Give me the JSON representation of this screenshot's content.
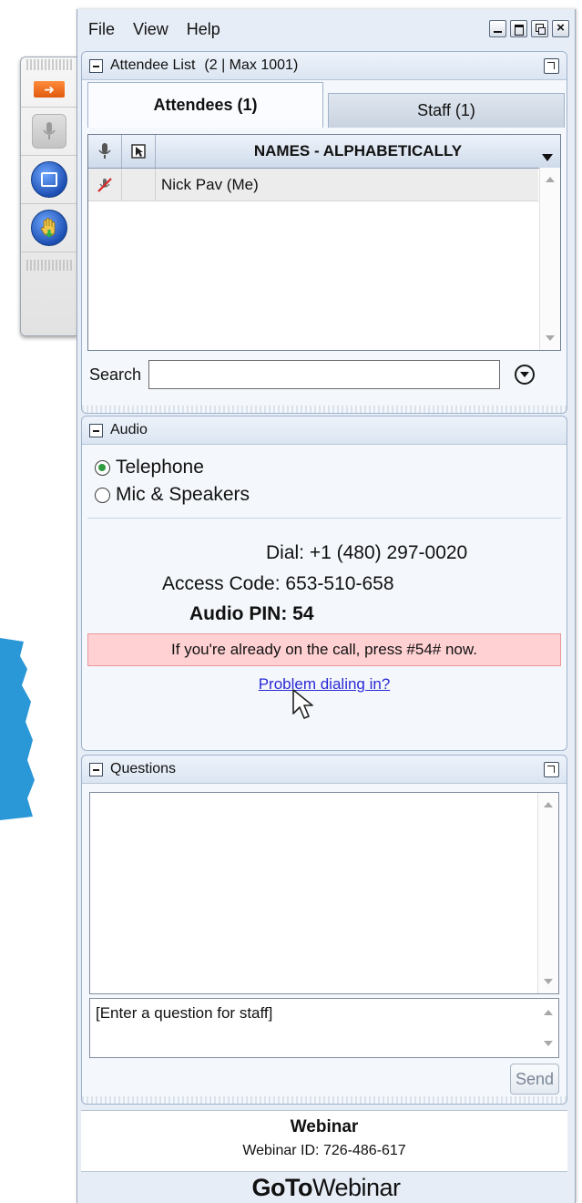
{
  "menu": {
    "file": "File",
    "view": "View",
    "help": "Help"
  },
  "attendee_list": {
    "title": "Attendee List",
    "count": "(2 | Max 1001)",
    "tabs": [
      {
        "label": "Attendees (1)"
      },
      {
        "label": "Staff (1)"
      }
    ],
    "column_header": "NAMES - ALPHABETICALLY",
    "rows": [
      {
        "name": "Nick Pav (Me)"
      }
    ],
    "search_label": "Search",
    "search_value": ""
  },
  "audio": {
    "title": "Audio",
    "options": [
      {
        "label": "Telephone",
        "selected": true
      },
      {
        "label": "Mic & Speakers",
        "selected": false
      }
    ],
    "dial": "Dial: +1 (480) 297-0020",
    "access_code": "Access Code: 653-510-658",
    "audio_pin": "Audio PIN: 54",
    "notice": "If you're already on the call, press #54# now.",
    "problem_link": "Problem dialing in?"
  },
  "questions": {
    "title": "Questions",
    "input_placeholder": "[Enter a question for staff]",
    "send_label": "Send"
  },
  "webinar": {
    "title": "Webinar",
    "id_text": "Webinar ID: 726-486-617"
  },
  "brand": {
    "bold": "GoTo",
    "light": "Webinar"
  },
  "colors": {
    "accent_orange": "#e05a10",
    "notice_bg": "#ffd1d3",
    "link": "#2a2ad6",
    "panel_bg": "#f4f7fb",
    "radio_on": "#2e9b3e"
  }
}
